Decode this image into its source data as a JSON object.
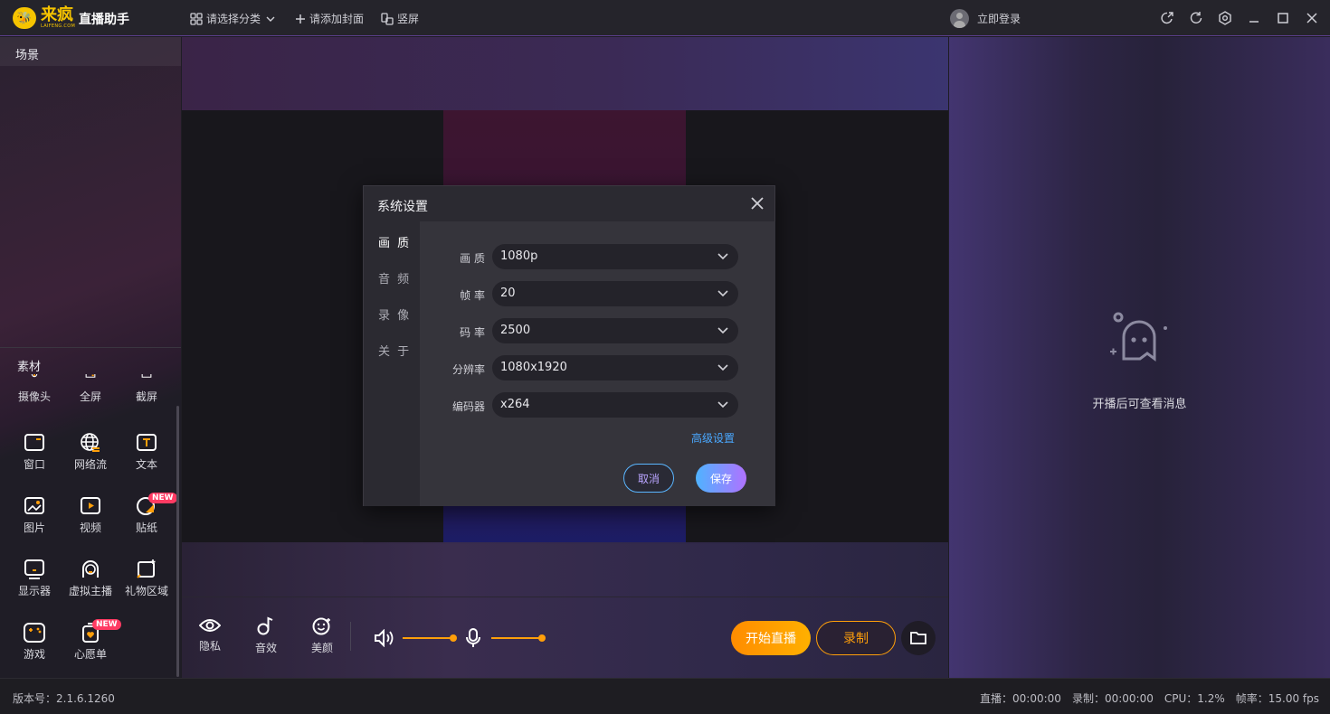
{
  "app": {
    "logo_text": "来疯",
    "logo_sub": "LAIFENG.COM",
    "title": "直播助手"
  },
  "toolbar": {
    "category": "请选择分类",
    "cover": "请添加封面",
    "portrait": "竖屏",
    "login": "立即登录"
  },
  "left": {
    "scene_title": "场景",
    "material_title": "素材",
    "tools": [
      {
        "label": "摄像头",
        "icon": "camera-icon"
      },
      {
        "label": "全屏",
        "icon": "fullscreen-icon"
      },
      {
        "label": "截屏",
        "icon": "screenshot-icon"
      },
      {
        "label": "窗口",
        "icon": "window-icon"
      },
      {
        "label": "网络流",
        "icon": "globe-icon"
      },
      {
        "label": "文本",
        "icon": "text-icon"
      },
      {
        "label": "图片",
        "icon": "image-icon"
      },
      {
        "label": "视频",
        "icon": "video-icon"
      },
      {
        "label": "贴纸",
        "icon": "sticker-icon"
      },
      {
        "label": "显示器",
        "icon": "monitor-icon"
      },
      {
        "label": "虚拟主播",
        "icon": "virtual-host-icon"
      },
      {
        "label": "礼物区域",
        "icon": "gift-area-icon"
      },
      {
        "label": "游戏",
        "icon": "gamepad-icon"
      },
      {
        "label": "心愿单",
        "icon": "wishlist-icon"
      }
    ],
    "new_badge": "NEW"
  },
  "controls": {
    "privacy": "隐私",
    "sound_effect": "音效",
    "beauty": "美颜",
    "start_live": "开始直播",
    "record": "录制"
  },
  "right": {
    "empty_message": "开播后可查看消息"
  },
  "status": {
    "version": "版本号：2.1.6.1260",
    "live": "直播：00:00:00",
    "record": "录制：00:00:00",
    "cpu": "CPU：1.2%",
    "fps": "帧率：15.00 fps"
  },
  "dialog": {
    "title": "系统设置",
    "nav": [
      "画 质",
      "音 频",
      "录 像",
      "关 于"
    ],
    "fields": [
      {
        "label": "画  质",
        "value": "1080p"
      },
      {
        "label": "帧  率",
        "value": "20"
      },
      {
        "label": "码  率",
        "value": "2500"
      },
      {
        "label": "分辨率",
        "value": "1080x1920"
      },
      {
        "label": "编码器",
        "value": "x264"
      }
    ],
    "advanced": "高级设置",
    "cancel": "取消",
    "save": "保存"
  },
  "colors": {
    "accent_orange": "#ff9f0a",
    "brand_yellow": "#f6c400",
    "link_blue": "#4aa8ff",
    "new_badge": "#ff3b63"
  }
}
